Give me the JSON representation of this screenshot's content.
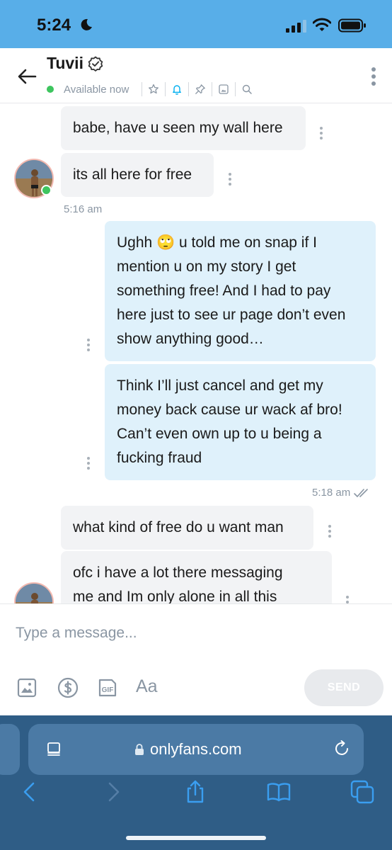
{
  "status_bar": {
    "time": "5:24"
  },
  "header": {
    "name": "Tuvii",
    "availability": "Available now",
    "icons": [
      "star-icon",
      "bell-icon",
      "pin-icon",
      "image-icon",
      "search-icon"
    ]
  },
  "messages": [
    {
      "direction": "incoming",
      "text": "babe, have u seen my wall here"
    },
    {
      "direction": "incoming",
      "text": "its all here for free"
    },
    {
      "direction": "outgoing",
      "lines": [
        "Ughh 🙄 u told me on snap if I",
        "mention u on my story I get",
        "something free! And I had to pay",
        "here just to see ur page don’t even",
        "show anything good…"
      ]
    },
    {
      "direction": "outgoing",
      "lines": [
        "Think I’ll just cancel and get my",
        "money back cause ur wack af bro!",
        "Can’t even own up to u being a",
        "fucking fraud"
      ]
    },
    {
      "direction": "incoming",
      "text": "what kind of free do u want man"
    },
    {
      "direction": "incoming",
      "lines": [
        "ofc i have a lot there messaging",
        "me and Im only alone in all this"
      ]
    }
  ],
  "timestamps": {
    "first": "5:16 am",
    "second": "5:18 am"
  },
  "composer": {
    "placeholder": "Type a message...",
    "aa_label": "Aa",
    "send_label": "SEND"
  },
  "browser": {
    "url": "onlyfans.com"
  },
  "colors": {
    "status_bar": "#58aee8",
    "incoming_bubble": "#f2f3f5",
    "outgoing_bubble": "#dff1fb",
    "accent": "#00aff0",
    "online": "#3ec55f",
    "browser_bar": "#2f5d86"
  }
}
